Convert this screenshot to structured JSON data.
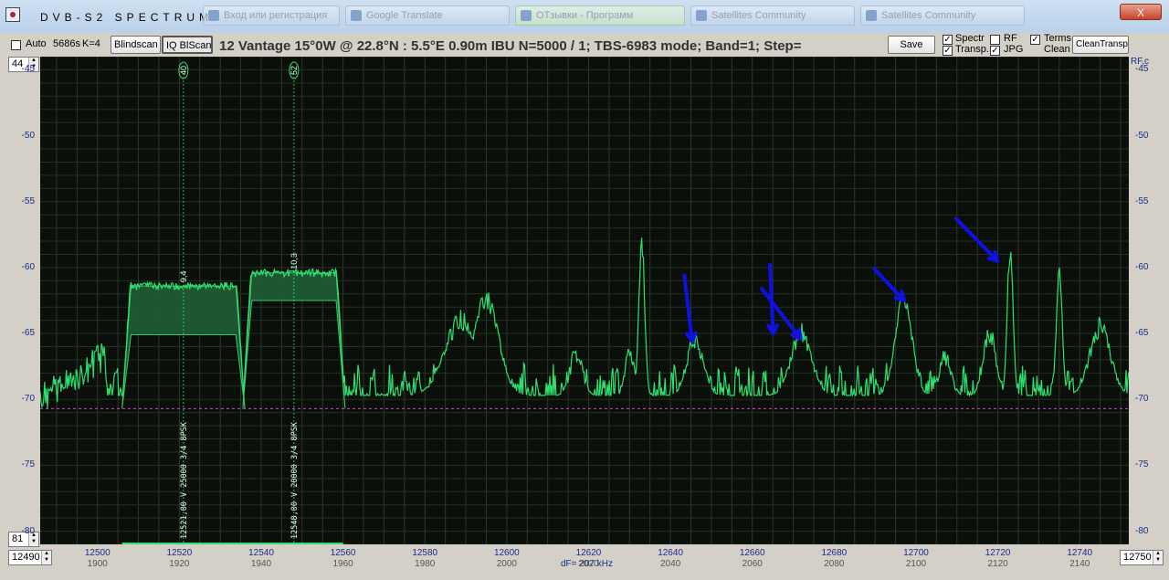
{
  "window": {
    "title": "DVB-S2   SPECTRUM",
    "taskbar_tabs": [
      "Вход или регистрация",
      "Google Translate",
      "ОТзывки - Программ",
      "Satellites Community",
      "Satellites Community"
    ],
    "close_label": "X"
  },
  "toolbar": {
    "auto_label": "Auto",
    "auto_checked": false,
    "scan_time": "5686s",
    "k_value": "K=4",
    "blindscan_label": "Blindscan",
    "iqblscan_label": "IQ BlScan",
    "info_text": "12 Vantage    15°0W  @  22.8°N : 5.5°E    0.90m  IBU    N=5000 / 1; TBS-6983 mode; Band=1; Step=",
    "save_label": "Save",
    "spectr_label": "Spectr",
    "spectr_checked": true,
    "transp_label": "Transp.",
    "transp_checked": true,
    "rf_label": "RF",
    "rf_checked": false,
    "jpg_label": "JPG",
    "jpg_checked": true,
    "terms_label": "Terms",
    "terms_checked": true,
    "clean_label": "Clean",
    "cleantransp_label": "CleanTransp"
  },
  "controls": {
    "top_spin": "44",
    "bottom_spin": "81",
    "freq_start": "12490",
    "freq_end": "12750",
    "df_label": "dF= 207 kHz",
    "rf_axis_label": "RF,c"
  },
  "chart_data": {
    "type": "line",
    "title": "",
    "xlabel": "",
    "ylabel": "",
    "xlim": [
      12486,
      12752
    ],
    "ylim": [
      -81,
      -44
    ],
    "y_ticks": [
      -45,
      -50,
      -55,
      -60,
      -65,
      -70,
      -75,
      -80
    ],
    "x_ticks": [
      12500,
      12520,
      12540,
      12560,
      12580,
      12600,
      12620,
      12640,
      12660,
      12680,
      12700,
      12720,
      12740
    ],
    "x_ticks_if": [
      "1900",
      "1920",
      "1940",
      "1960",
      "1980",
      "2000",
      "2020",
      "2040",
      "2060",
      "2080",
      "2100",
      "2120",
      "2140"
    ],
    "noise_floor_db": -70.7,
    "signal_color": "#2fe070",
    "marker_color": "#d040d0",
    "annotation_color": "#1010e0",
    "transponders": [
      {
        "freq": 12521.0,
        "sr_ksps": 25000,
        "top_db": -61.4,
        "bottom_db": -65.1,
        "half_bw_mhz": 15.0,
        "tp_number": "40",
        "snr": "9,4",
        "label": "12521,00  V  25000 3/4  8PSK"
      },
      {
        "freq": 12548.0,
        "sr_ksps": 20000,
        "top_db": -60.4,
        "bottom_db": -62.5,
        "half_bw_mhz": 12.5,
        "tp_number": "52",
        "snr": "10,3",
        "label": "12548,00  V  20000 3/4  8PSK"
      }
    ],
    "spectrum_peaks": [
      {
        "freq": 12576,
        "db": -69.5,
        "half_width": 3
      },
      {
        "freq": 12589,
        "db": -64.0,
        "half_width": 4
      },
      {
        "freq": 12595,
        "db": -62.5,
        "half_width": 3
      },
      {
        "freq": 12617,
        "db": -66.5,
        "half_width": 1.5
      },
      {
        "freq": 12630,
        "db": -66.0,
        "half_width": 1
      },
      {
        "freq": 12633,
        "db": -58.0,
        "half_width": 0.7
      },
      {
        "freq": 12646,
        "db": -65.5,
        "half_width": 2
      },
      {
        "freq": 12672,
        "db": -65.0,
        "half_width": 2.5
      },
      {
        "freq": 12697,
        "db": -62.3,
        "half_width": 2
      },
      {
        "freq": 12707,
        "db": -67.0,
        "half_width": 1.5
      },
      {
        "freq": 12718,
        "db": -65.0,
        "half_width": 1.5
      },
      {
        "freq": 12723,
        "db": -58.7,
        "half_width": 0.7
      },
      {
        "freq": 12735,
        "db": -60.0,
        "half_width": 0.7
      },
      {
        "freq": 12745,
        "db": -64.5,
        "half_width": 2.5
      }
    ],
    "arrows": [
      {
        "from": [
          12643.4,
          -60.6
        ],
        "to": [
          12645.3,
          -65.6
        ]
      },
      {
        "from": [
          12662.3,
          -61.6
        ],
        "to": [
          12671.8,
          -65.4
        ]
      },
      {
        "from": [
          12664.3,
          -59.8
        ],
        "to": [
          12665.1,
          -65.0
        ]
      },
      {
        "from": [
          12689.8,
          -60.1
        ],
        "to": [
          12697.1,
          -62.5
        ]
      },
      {
        "from": [
          12709.8,
          -56.3
        ],
        "to": [
          12719.9,
          -59.5
        ]
      }
    ]
  }
}
